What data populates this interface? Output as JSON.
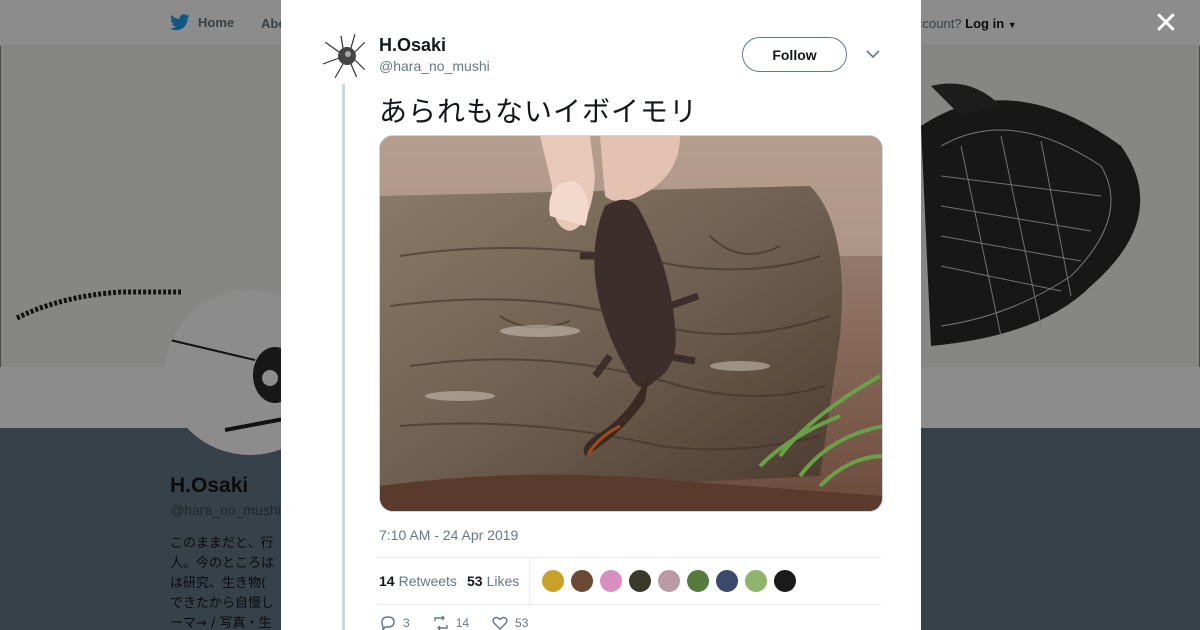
{
  "nav": {
    "home_label": "Home",
    "about_label": "Abo",
    "account_prompt": "ccount?",
    "login_label": "Log in"
  },
  "profile": {
    "name": "H.Osaki",
    "handle": "@hara_no_mushi",
    "bio": "このままだと、行\n人。今のところは\nは研究、生き物(\nできたから自慢し\nーマ→ / 写真・生"
  },
  "tweet": {
    "author_name": "H.Osaki",
    "author_handle": "@hara_no_mushi",
    "follow_label": "Follow",
    "text": "あられもないイボイモリ",
    "timestamp": "7:10 AM - 24 Apr 2019",
    "retweets_count": "14",
    "retweets_label": "Retweets",
    "likes_count": "53",
    "likes_label": "Likes",
    "reply_count": "3",
    "retweet_action_count": "14",
    "like_action_count": "53"
  },
  "likers": [
    {
      "color": "#c9a12a"
    },
    {
      "color": "#6b4a35"
    },
    {
      "color": "#d98ec0"
    },
    {
      "color": "#3a3a2a"
    },
    {
      "color": "#b99aa5"
    },
    {
      "color": "#557a3b"
    },
    {
      "color": "#3b4a6a"
    },
    {
      "color": "#8fb46a"
    },
    {
      "color": "#1a1a1a"
    }
  ],
  "icons": {
    "close": "close-icon",
    "twitter": "twitter-bird-icon",
    "caret": "caret-down-icon",
    "chevron": "chevron-down-icon",
    "reply": "reply-icon",
    "retweet": "retweet-icon",
    "like": "heart-icon"
  },
  "colors": {
    "brand": "#1da1f2",
    "text": "#14171a",
    "muted": "#657786"
  }
}
